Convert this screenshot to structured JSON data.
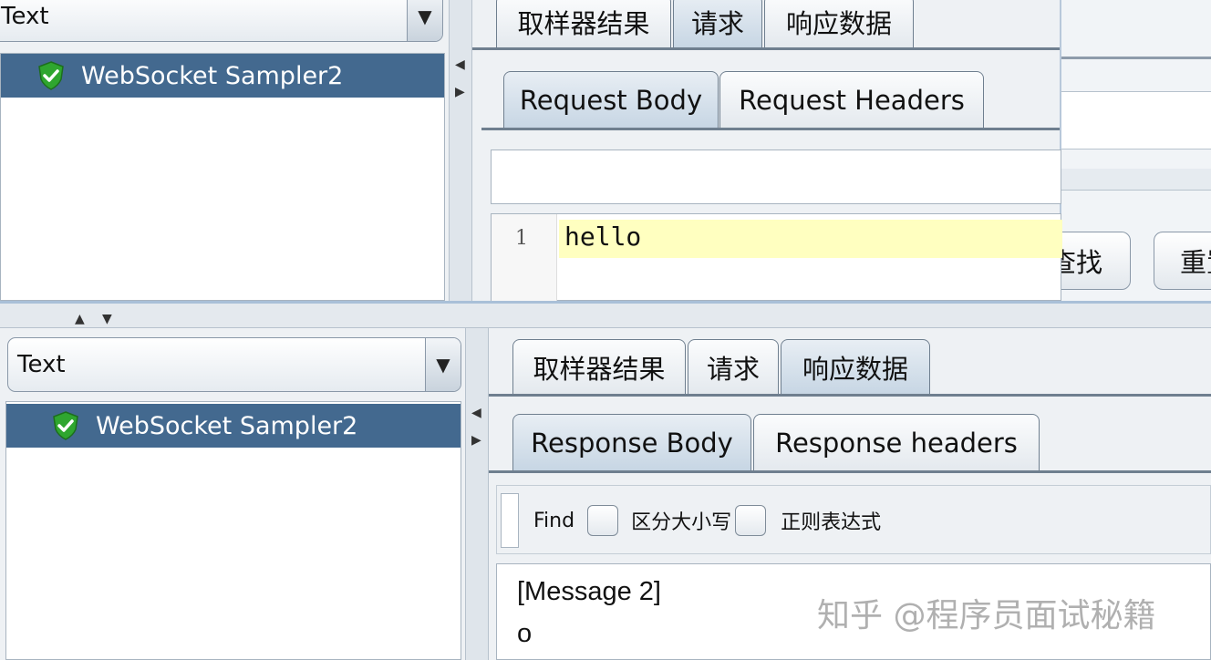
{
  "top": {
    "renderer_combo": {
      "value": "Text"
    },
    "tree_item": {
      "label": "WebSocket Sampler2"
    },
    "main_tabs": [
      {
        "label": "取样器结果"
      },
      {
        "label": "请求"
      },
      {
        "label": "响应数据"
      }
    ],
    "sub_tabs": [
      {
        "label": "Request Body"
      },
      {
        "label": "Request Headers"
      }
    ],
    "editor": {
      "line_number": "1",
      "line_text": "hello"
    },
    "background_buttons": {
      "find": "查找",
      "reset": "重置"
    }
  },
  "bottom": {
    "renderer_combo": {
      "value": "Text"
    },
    "tree_item": {
      "label": "WebSocket Sampler2"
    },
    "main_tabs": [
      {
        "label": "取样器结果"
      },
      {
        "label": "请求"
      },
      {
        "label": "响应数据"
      }
    ],
    "sub_tabs": [
      {
        "label": "Response Body"
      },
      {
        "label": "Response headers"
      }
    ],
    "search": {
      "find_label": "Find",
      "case_label": "区分大小写",
      "regex_label": "正则表达式"
    },
    "content": {
      "line1": "[Message 2]",
      "line2": "o"
    }
  },
  "watermark": "知乎 @程序员面试秘籍",
  "colors": {
    "selection": "#43698f",
    "highlight_line": "#ffffc0",
    "brand_shield": "#2fa62f"
  }
}
